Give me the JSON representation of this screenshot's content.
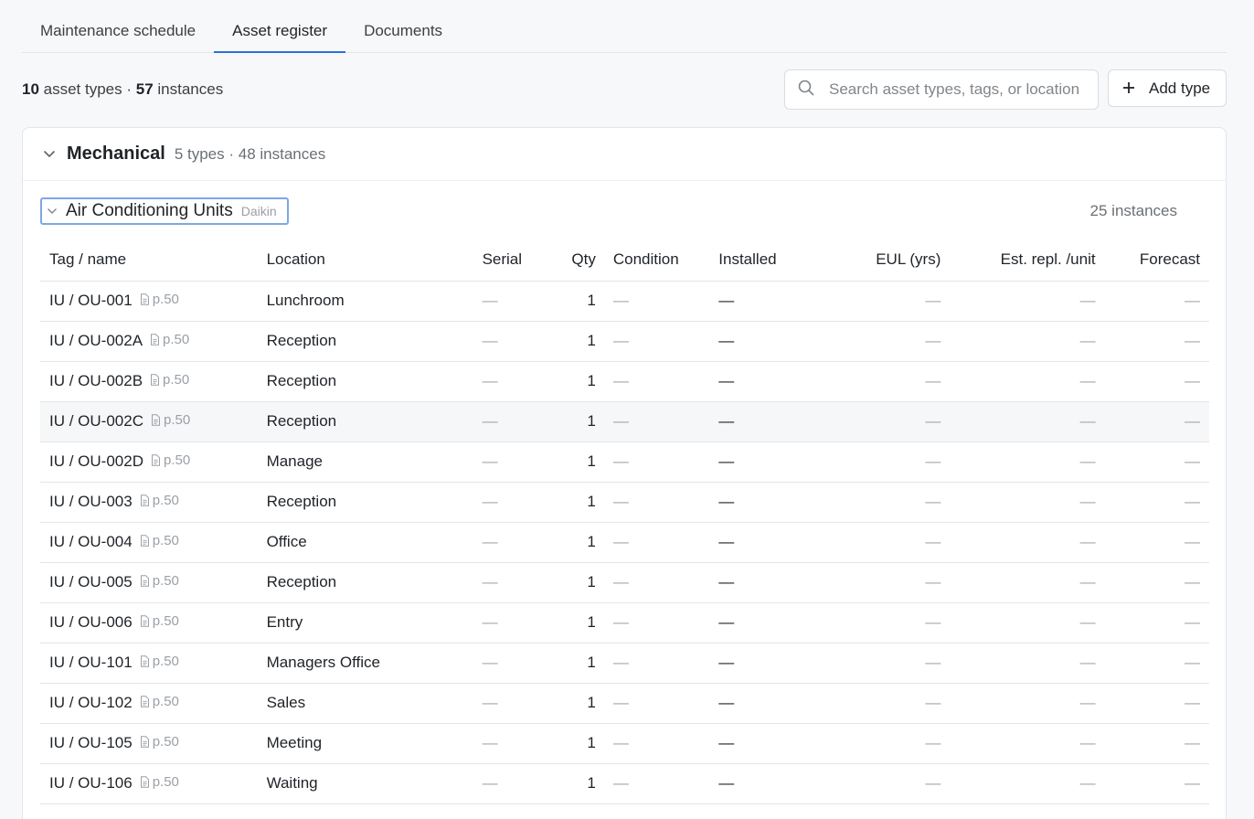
{
  "tabs": [
    {
      "label": "Maintenance schedule"
    },
    {
      "label": "Asset register"
    },
    {
      "label": "Documents"
    }
  ],
  "summary": {
    "types_count": "10",
    "types_label": " asset types · ",
    "instances_count": "57",
    "instances_label": " instances"
  },
  "search": {
    "placeholder": "Search asset types, tags, or location"
  },
  "add_button": {
    "label": "Add type"
  },
  "category": {
    "title": "Mechanical",
    "meta": "5 types · 48 instances"
  },
  "asset_type": {
    "title": "Air Conditioning Units",
    "manufacturer": "Daikin",
    "instances": "25 instances"
  },
  "table": {
    "headers": [
      "Tag / name",
      "Location",
      "Serial",
      "Qty",
      "Condition",
      "Installed",
      "EUL (yrs)",
      "Est. repl. /unit",
      "Forecast"
    ],
    "rows": [
      {
        "tag": "IU / OU-001",
        "ref": "p.50",
        "location": "Lunchroom",
        "serial": "—",
        "qty": "1",
        "condition": "—",
        "installed": "—",
        "eul": "—",
        "repl": "—",
        "forecast": "—"
      },
      {
        "tag": "IU / OU-002A",
        "ref": "p.50",
        "location": "Reception",
        "serial": "—",
        "qty": "1",
        "condition": "—",
        "installed": "—",
        "eul": "—",
        "repl": "—",
        "forecast": "—"
      },
      {
        "tag": "IU / OU-002B",
        "ref": "p.50",
        "location": "Reception",
        "serial": "—",
        "qty": "1",
        "condition": "—",
        "installed": "—",
        "eul": "—",
        "repl": "—",
        "forecast": "—"
      },
      {
        "tag": "IU / OU-002C",
        "ref": "p.50",
        "location": "Reception",
        "serial": "—",
        "qty": "1",
        "condition": "—",
        "installed": "—",
        "eul": "—",
        "repl": "—",
        "forecast": "—"
      },
      {
        "tag": "IU / OU-002D",
        "ref": "p.50",
        "location": "Manage",
        "serial": "—",
        "qty": "1",
        "condition": "—",
        "installed": "—",
        "eul": "—",
        "repl": "—",
        "forecast": "—"
      },
      {
        "tag": "IU / OU-003",
        "ref": "p.50",
        "location": "Reception",
        "serial": "—",
        "qty": "1",
        "condition": "—",
        "installed": "—",
        "eul": "—",
        "repl": "—",
        "forecast": "—"
      },
      {
        "tag": "IU / OU-004",
        "ref": "p.50",
        "location": "Office",
        "serial": "—",
        "qty": "1",
        "condition": "—",
        "installed": "—",
        "eul": "—",
        "repl": "—",
        "forecast": "—"
      },
      {
        "tag": "IU / OU-005",
        "ref": "p.50",
        "location": "Reception",
        "serial": "—",
        "qty": "1",
        "condition": "—",
        "installed": "—",
        "eul": "—",
        "repl": "—",
        "forecast": "—"
      },
      {
        "tag": "IU / OU-006",
        "ref": "p.50",
        "location": "Entry",
        "serial": "—",
        "qty": "1",
        "condition": "—",
        "installed": "—",
        "eul": "—",
        "repl": "—",
        "forecast": "—"
      },
      {
        "tag": "IU / OU-101",
        "ref": "p.50",
        "location": "Managers Office",
        "serial": "—",
        "qty": "1",
        "condition": "—",
        "installed": "—",
        "eul": "—",
        "repl": "—",
        "forecast": "—"
      },
      {
        "tag": "IU / OU-102",
        "ref": "p.50",
        "location": "Sales",
        "serial": "—",
        "qty": "1",
        "condition": "—",
        "installed": "—",
        "eul": "—",
        "repl": "—",
        "forecast": "—"
      },
      {
        "tag": "IU / OU-105",
        "ref": "p.50",
        "location": "Meeting",
        "serial": "—",
        "qty": "1",
        "condition": "—",
        "installed": "—",
        "eul": "—",
        "repl": "—",
        "forecast": "—"
      },
      {
        "tag": "IU / OU-106",
        "ref": "p.50",
        "location": "Waiting",
        "serial": "—",
        "qty": "1",
        "condition": "—",
        "installed": "—",
        "eul": "—",
        "repl": "—",
        "forecast": "—"
      }
    ]
  },
  "colors": {
    "accent": "#2f6fd6",
    "focus_outline": "#7fa6e6",
    "muted_text": "#6b7075"
  },
  "icons": {
    "search": "search-icon",
    "add": "plus-icon",
    "collapse": "chevron-down-icon",
    "document": "document-icon"
  }
}
